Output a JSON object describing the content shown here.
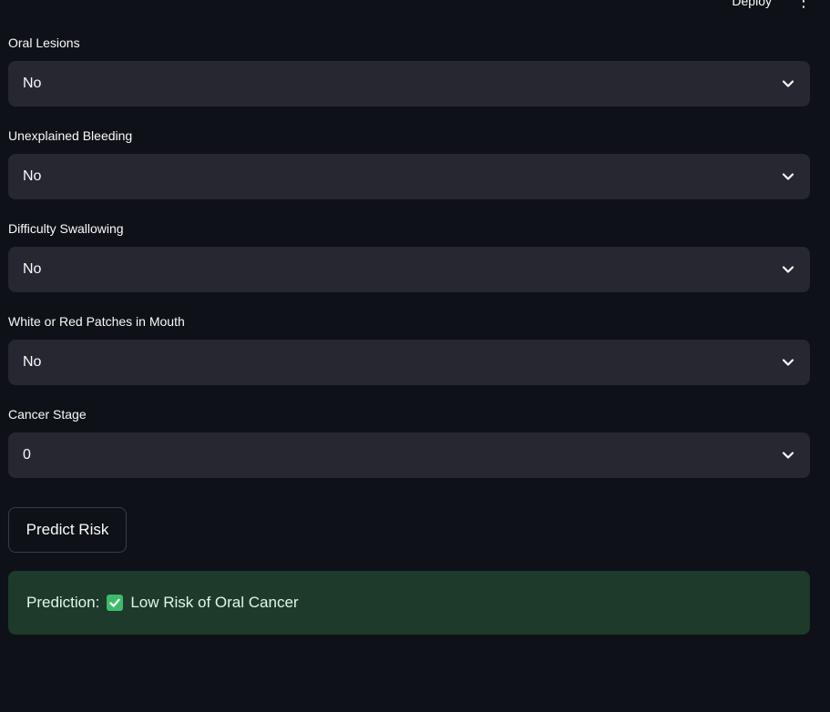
{
  "header": {
    "deploy_label": "Deploy",
    "menu_glyph": "⋮"
  },
  "fields": [
    {
      "label": "Oral Lesions",
      "value": "No"
    },
    {
      "label": "Unexplained Bleeding",
      "value": "No"
    },
    {
      "label": "Difficulty Swallowing",
      "value": "No"
    },
    {
      "label": "White or Red Patches in Mouth",
      "value": "No"
    },
    {
      "label": "Cancer Stage",
      "value": "0"
    }
  ],
  "predict_button": {
    "label": "Predict Risk"
  },
  "result": {
    "prefix": "Prediction:",
    "text": "Low Risk of Oral Cancer",
    "status_icon": "check-mark-icon",
    "background": "#1d3a2b",
    "icon_color": "#3dbb6b"
  },
  "theme": {
    "background": "#0e1117",
    "select_background": "#262730"
  }
}
